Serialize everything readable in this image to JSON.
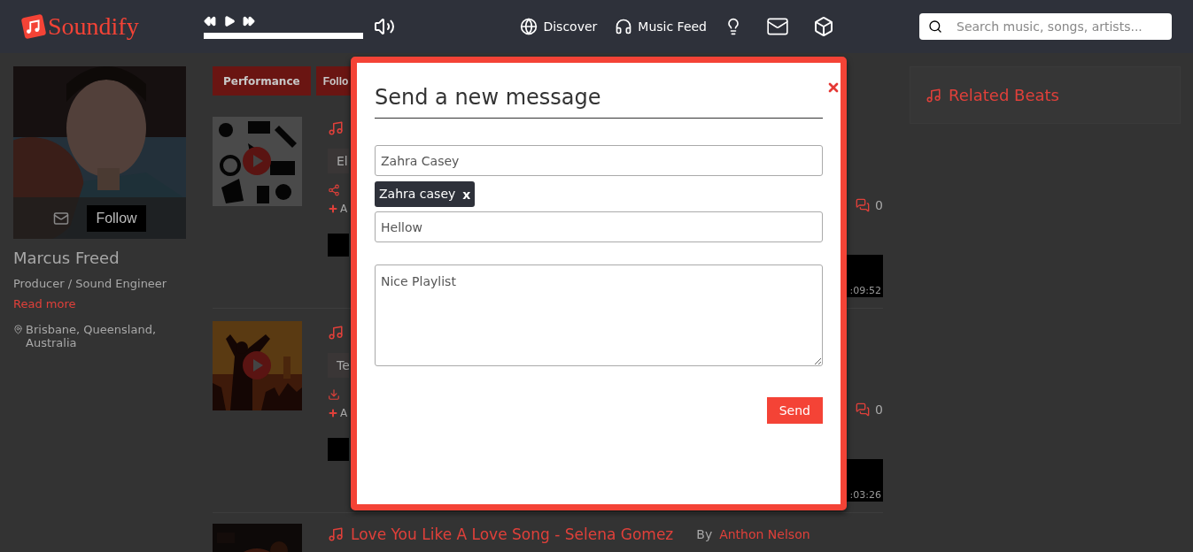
{
  "header": {
    "logo": "Soundify",
    "nav": [
      {
        "label": "Discover"
      },
      {
        "label": "Music Feed"
      }
    ],
    "search": {
      "placeholder": "Search music, songs, artists..."
    }
  },
  "profile": {
    "follow_button": "Follow",
    "name": "Marcus Freed",
    "role": "Producer / Sound Engineer",
    "read_more": "Read more",
    "location": "Brisbane, Queensland, Australia"
  },
  "tabs": [
    {
      "label": "Performance"
    },
    {
      "label": "Follo"
    }
  ],
  "tracks": [
    {
      "kind": "covered",
      "tag": "El",
      "add": "A",
      "comments": "0",
      "time": ":09:52"
    },
    {
      "kind": "covered",
      "tag": "Te",
      "add": "A",
      "comments": "0",
      "time": ":03:26"
    },
    {
      "kind": "open",
      "title": "Love You Like A Love Song - Selena Gomez",
      "by": "By",
      "author": "Anthon Nelson"
    }
  ],
  "sidebar": {
    "title": "Related Beats"
  },
  "modal": {
    "title": "Send a new message",
    "recipient": {
      "value": "Zahra Casey"
    },
    "chips": [
      {
        "label": "Zahra casey",
        "remove": "x"
      }
    ],
    "subject": {
      "value": "Hellow"
    },
    "body": {
      "value": "Nice Playlist"
    },
    "send": "Send"
  }
}
